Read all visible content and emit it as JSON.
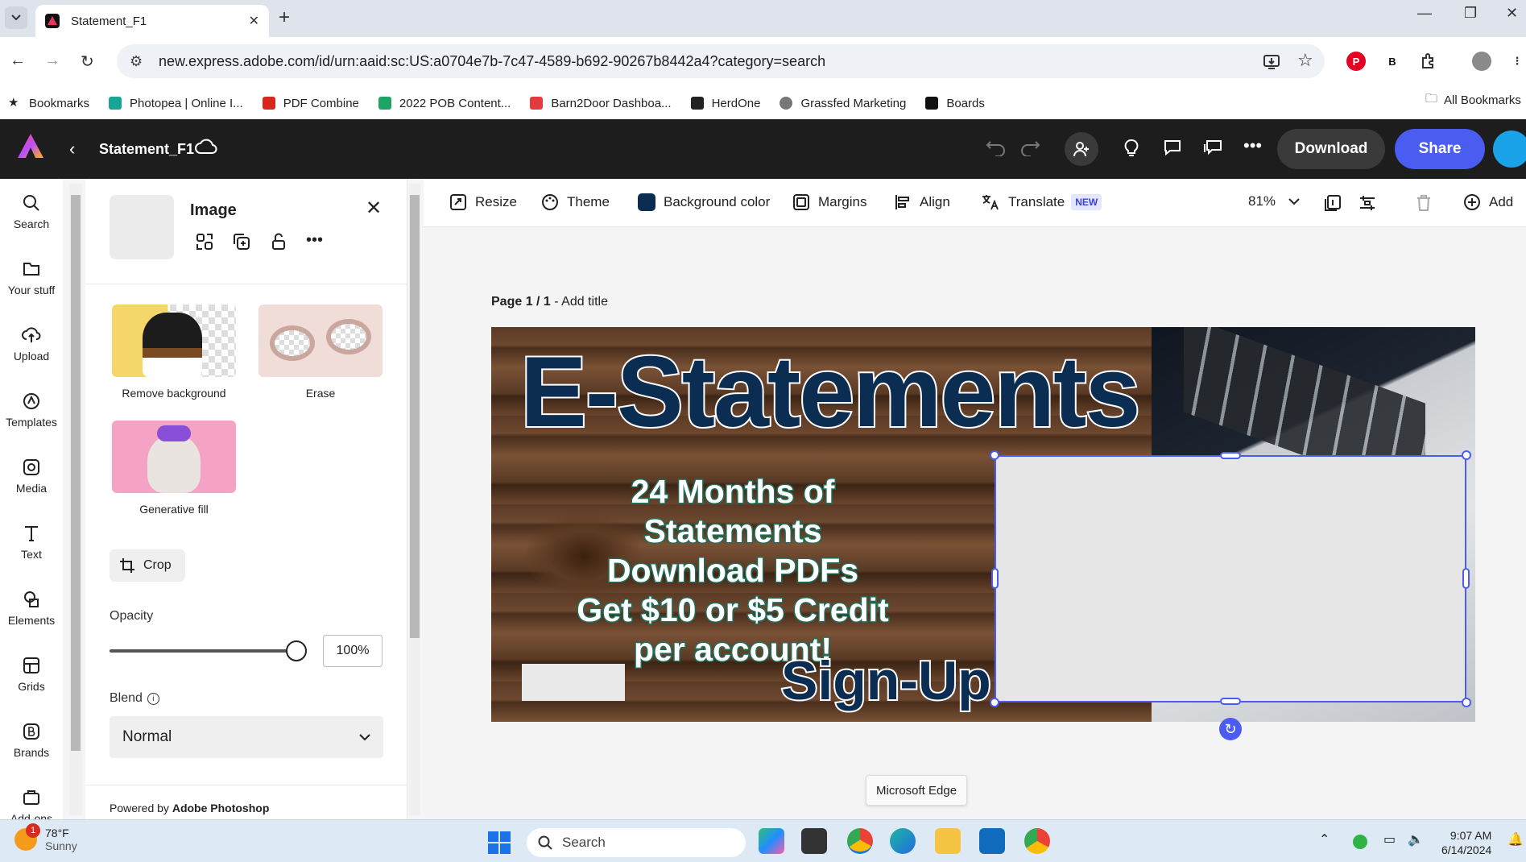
{
  "browser": {
    "tab_title": "Statement_F1",
    "url": "new.express.adobe.com/id/urn:aaid:sc:US:a0704e7b-7c47-4589-b692-90267b8442a4?category=search",
    "bookmarks": [
      {
        "label": "Bookmarks",
        "color": "#333333"
      },
      {
        "label": "Photopea | Online I...",
        "color": "#18a497"
      },
      {
        "label": "PDF Combine",
        "color": "#d7261e"
      },
      {
        "label": "2022 POB Content...",
        "color": "#1fa463"
      },
      {
        "label": "Barn2Door Dashboa...",
        "color": "#e23c3c"
      },
      {
        "label": "HerdOne",
        "color": "#222222"
      },
      {
        "label": "Grassfed Marketing",
        "color": "#777777"
      },
      {
        "label": "Boards",
        "color": "#111111"
      }
    ],
    "all_bookmarks": "All Bookmarks"
  },
  "app": {
    "doc_name": "Statement_F1",
    "download_label": "Download",
    "share_label": "Share",
    "accent": "#4b5cf0"
  },
  "rail": [
    {
      "label": "Search",
      "icon": "search-icon"
    },
    {
      "label": "Your stuff",
      "icon": "folder-icon"
    },
    {
      "label": "Upload",
      "icon": "upload-icon"
    },
    {
      "label": "Templates",
      "icon": "templates-icon"
    },
    {
      "label": "Media",
      "icon": "media-icon"
    },
    {
      "label": "Text",
      "icon": "text-icon"
    },
    {
      "label": "Elements",
      "icon": "elements-icon"
    },
    {
      "label": "Grids",
      "icon": "grids-icon"
    },
    {
      "label": "Brands",
      "icon": "brands-icon"
    },
    {
      "label": "Add-ons",
      "icon": "addons-icon"
    }
  ],
  "panel": {
    "title": "Image",
    "features": [
      {
        "label": "Remove background"
      },
      {
        "label": "Erase"
      },
      {
        "label": "Generative fill"
      }
    ],
    "crop_label": "Crop",
    "opacity_label": "Opacity",
    "opacity_value": "100%",
    "opacity_fraction": 1.0,
    "blend_label": "Blend",
    "blend_value": "Normal",
    "footer_prefix": "Powered by ",
    "footer_brand": "Adobe Photoshop"
  },
  "toolbar": {
    "resize": "Resize",
    "theme": "Theme",
    "background_color": "Background color",
    "margins": "Margins",
    "align": "Align",
    "translate": "Translate",
    "new_badge": "NEW",
    "zoom": "81%",
    "add": "Add"
  },
  "canvas": {
    "page_label": "Page 1 / 1",
    "page_sep": " - ",
    "add_title": "Add title",
    "headline": "E-Statements",
    "lines": [
      "24 Months of Statements",
      "Download PDFs",
      "Get $10 or $5 Credit",
      "per account!"
    ],
    "signup": "Sign-Up T",
    "tooltip": "Microsoft Edge"
  },
  "taskbar": {
    "temp": "78°F",
    "condition": "Sunny",
    "badge": "1",
    "search": "Search",
    "time": "9:07 AM",
    "date": "6/14/2024"
  }
}
